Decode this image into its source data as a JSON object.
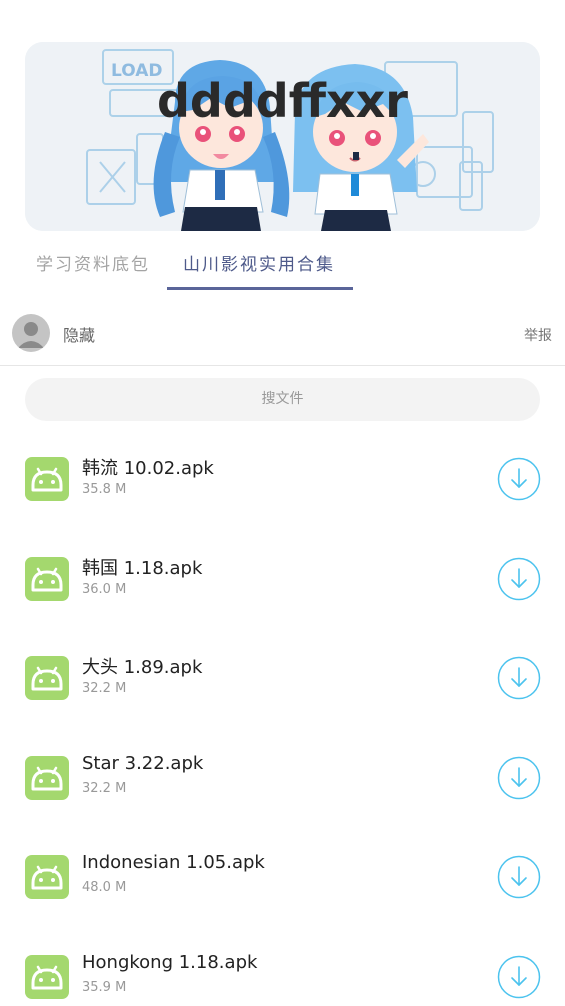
{
  "banner": {
    "text": "ddddffxxr"
  },
  "tabs": [
    {
      "label": "学习资料底包",
      "active": false
    },
    {
      "label": "山川影视实用合集",
      "active": true
    }
  ],
  "owner": {
    "name": "隐藏",
    "report_label": "举报"
  },
  "search": {
    "placeholder": "搜文件"
  },
  "files": [
    {
      "name": "韩流 10.02.apk",
      "size": "35.8 M"
    },
    {
      "name": "韩国 1.18.apk",
      "size": "36.0 M"
    },
    {
      "name": "大头 1.89.apk",
      "size": "32.2 M"
    },
    {
      "name": "Star 3.22.apk",
      "size": "32.2 M"
    },
    {
      "name": "Indonesian 1.05.apk",
      "size": "48.0 M"
    },
    {
      "name": "Hongkong 1.18.apk",
      "size": "35.9 M"
    }
  ],
  "colors": {
    "accent": "#5a6599",
    "download": "#4cc3ee",
    "android_icon": "#a4d86e"
  },
  "icons": {
    "file": "android-icon",
    "download": "download-icon",
    "avatar": "user-avatar-icon"
  }
}
